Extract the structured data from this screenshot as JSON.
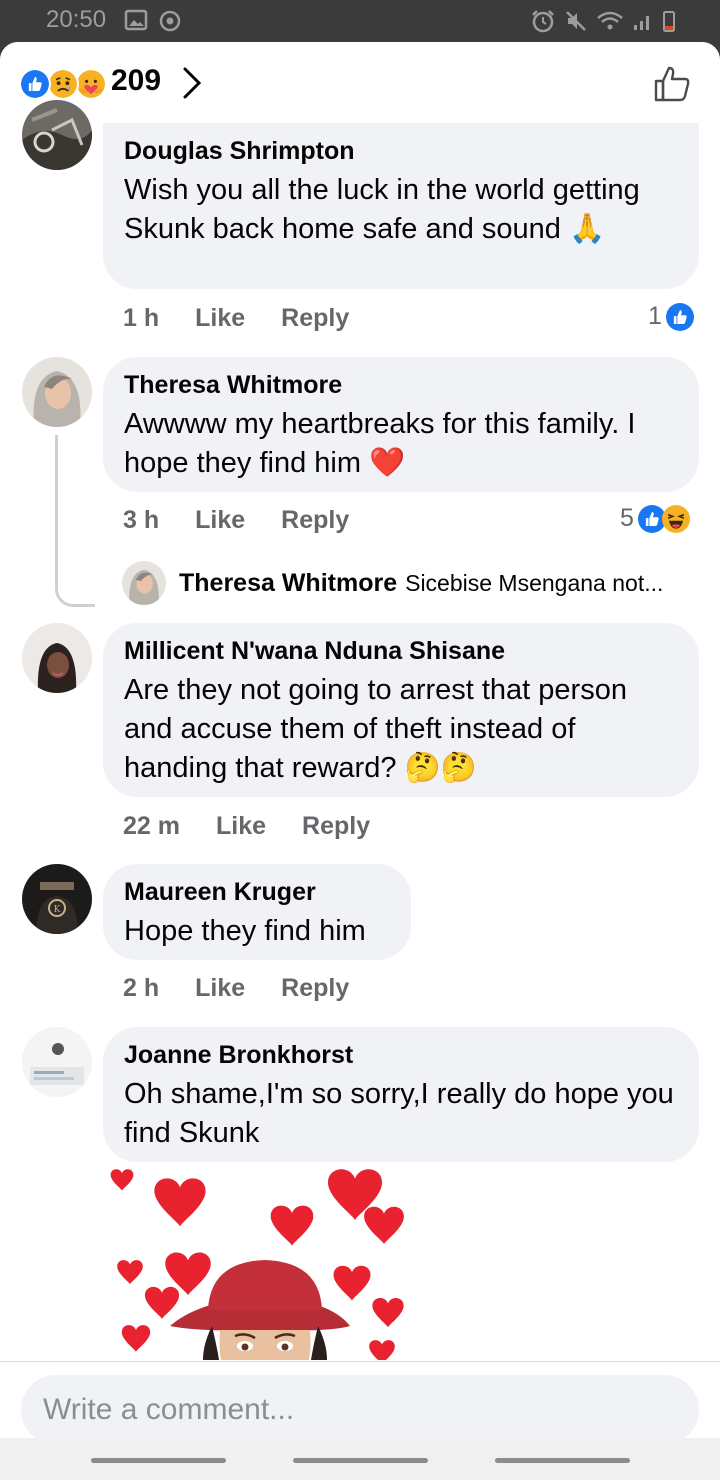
{
  "status_bar": {
    "time": "20:50"
  },
  "header": {
    "reaction_count": "209"
  },
  "comments": [
    {
      "author": "Douglas Shrimpton",
      "text": "Wish you all the luck in the world getting Skunk back home safe and sound",
      "emoji": "🙏",
      "time": "1 h",
      "like": "Like",
      "reply": "Reply",
      "reaction_count": "1"
    },
    {
      "author": "Theresa Whitmore",
      "text": "Awwww my heartbreaks for this family. I hope they find him",
      "emoji": "❤️",
      "time": "3 h",
      "like": "Like",
      "reply": "Reply",
      "reaction_count": "5",
      "reply_preview": {
        "author": "Theresa Whitmore",
        "text": "Sicebise Msengana not..."
      }
    },
    {
      "author": "Millicent N'wana Nduna Shisane",
      "text": "Are they not going to arrest that person and accuse them of theft instead of handing that reward?",
      "emoji": "🤔🤔",
      "time": "22 m",
      "like": "Like",
      "reply": "Reply"
    },
    {
      "author": "Maureen Kruger",
      "text": "Hope they find him",
      "time": "2 h",
      "like": "Like",
      "reply": "Reply"
    },
    {
      "author": "Joanne Bronkhorst",
      "text": "Oh shame,I'm so sorry,I really do hope you find Skunk"
    }
  ],
  "composer": {
    "placeholder": "Write a comment..."
  },
  "colors": {
    "like_blue": "#1877f2",
    "bubble": "#f0f2f5",
    "meta_gray": "#65676b"
  },
  "icons": [
    "like-reaction-icon",
    "sad-reaction-icon",
    "care-reaction-icon",
    "haha-reaction-icon",
    "chevron-right-icon",
    "thumbs-up-outline-icon"
  ]
}
